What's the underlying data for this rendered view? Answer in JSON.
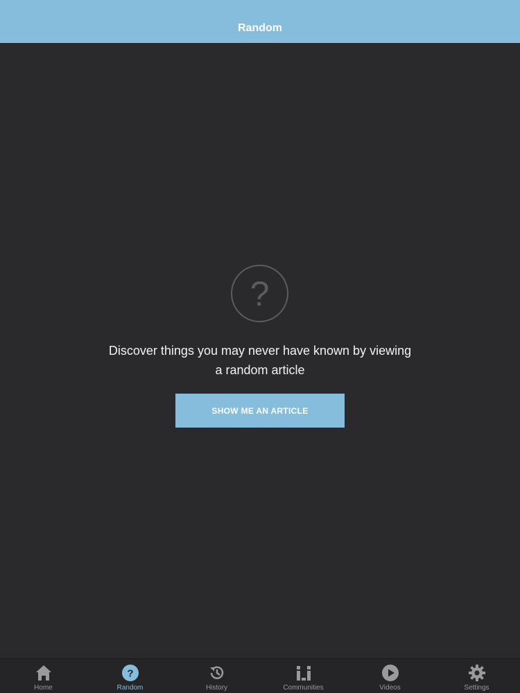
{
  "header": {
    "title": "Random"
  },
  "main": {
    "icon": "question-mark-icon",
    "icon_glyph": "?",
    "message": "Discover things you may never have known by viewing a random article",
    "button_label": "SHOW ME AN ARTICLE"
  },
  "tabs": [
    {
      "label": "Home",
      "icon": "home-icon",
      "active": false
    },
    {
      "label": "Random",
      "icon": "question-icon",
      "active": true
    },
    {
      "label": "History",
      "icon": "history-icon",
      "active": false
    },
    {
      "label": "Communities",
      "icon": "communities-icon",
      "active": false
    },
    {
      "label": "Videos",
      "icon": "play-icon",
      "active": false
    },
    {
      "label": "Settings",
      "icon": "gear-icon",
      "active": false
    }
  ],
  "colors": {
    "accent": "#86bcdc",
    "background": "#2a292c",
    "tab_inactive": "#9a9a9c"
  }
}
